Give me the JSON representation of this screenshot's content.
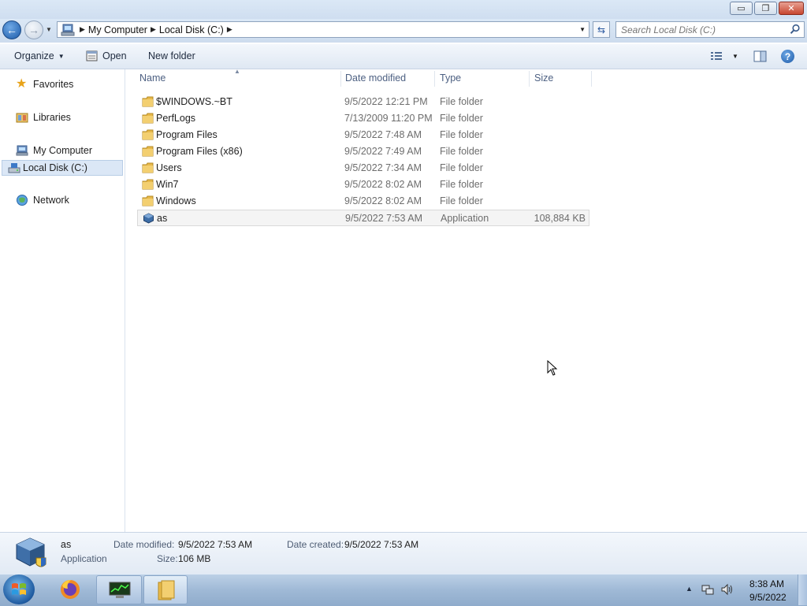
{
  "window": {
    "minimize": "▭",
    "maximize": "❐",
    "close": "✕"
  },
  "address": {
    "crumbs": [
      "My Computer",
      "Local Disk (C:)"
    ]
  },
  "search": {
    "placeholder": "Search Local Disk (C:)"
  },
  "toolbar": {
    "organize": "Organize",
    "open": "Open",
    "new_folder": "New folder"
  },
  "nav": {
    "favorites": "Favorites",
    "libraries": "Libraries",
    "my_computer": "My Computer",
    "local_disk": "Local Disk (C:)",
    "network": "Network"
  },
  "columns": {
    "name": "Name",
    "date": "Date modified",
    "type": "Type",
    "size": "Size"
  },
  "files": [
    {
      "name": "$WINDOWS.~BT",
      "date": "9/5/2022 12:21 PM",
      "type": "File folder",
      "size": "",
      "icon": "folder-icon"
    },
    {
      "name": "PerfLogs",
      "date": "7/13/2009 11:20 PM",
      "type": "File folder",
      "size": "",
      "icon": "folder-icon"
    },
    {
      "name": "Program Files",
      "date": "9/5/2022 7:48 AM",
      "type": "File folder",
      "size": "",
      "icon": "folder-icon"
    },
    {
      "name": "Program Files (x86)",
      "date": "9/5/2022 7:49 AM",
      "type": "File folder",
      "size": "",
      "icon": "folder-icon"
    },
    {
      "name": "Users",
      "date": "9/5/2022 7:34 AM",
      "type": "File folder",
      "size": "",
      "icon": "folder-icon"
    },
    {
      "name": "Win7",
      "date": "9/5/2022 8:02 AM",
      "type": "File folder",
      "size": "",
      "icon": "folder-icon"
    },
    {
      "name": "Windows",
      "date": "9/5/2022 8:02 AM",
      "type": "File folder",
      "size": "",
      "icon": "folder-icon"
    },
    {
      "name": "as",
      "date": "9/5/2022 7:53 AM",
      "type": "Application",
      "size": "108,884 KB",
      "icon": "application-icon",
      "selected": true
    }
  ],
  "details": {
    "name": "as",
    "type": "Application",
    "date_modified_label": "Date modified:",
    "date_modified": "9/5/2022 7:53 AM",
    "date_created_label": "Date created:",
    "date_created": "9/5/2022 7:53 AM",
    "size_label": "Size:",
    "size": "106 MB"
  },
  "taskbar": {
    "time": "8:38 AM",
    "date": "9/5/2022"
  },
  "colors": {
    "accent": "#1c5aa8",
    "folder": "#e8b94a",
    "selected_row": "#f4f4f4"
  }
}
